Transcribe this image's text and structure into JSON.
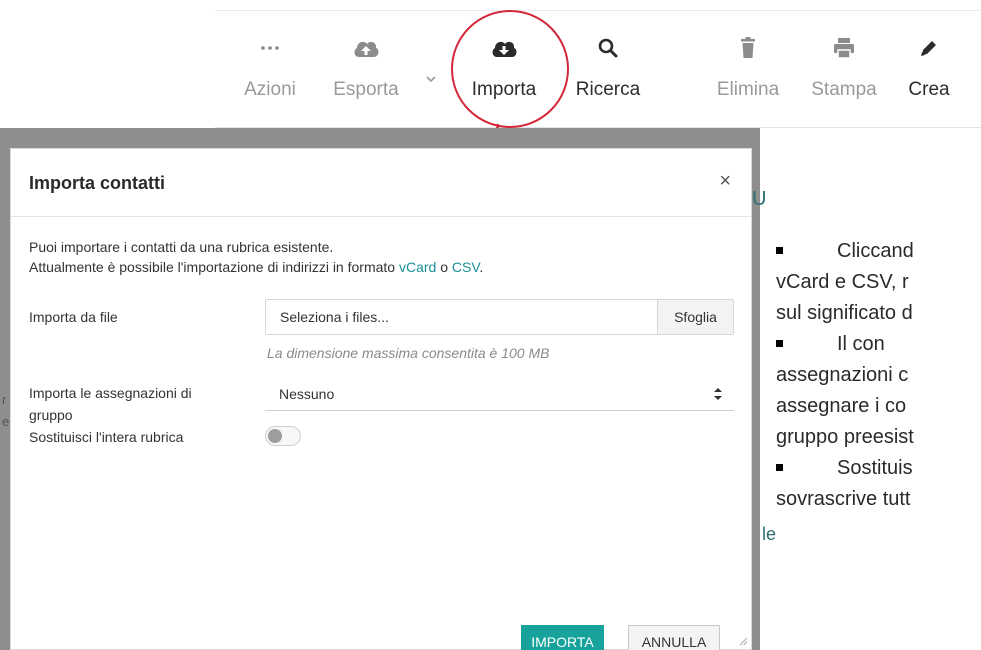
{
  "toolbar": {
    "items": [
      {
        "label": "Azioni",
        "icon": "more-icon"
      },
      {
        "label": "Esporta",
        "icon": "cloud-upload-icon"
      },
      {
        "label": "Importa",
        "icon": "cloud-download-icon"
      },
      {
        "label": "Ricerca",
        "icon": "search-icon"
      },
      {
        "label": "Elimina",
        "icon": "trash-icon"
      },
      {
        "label": "Stampa",
        "icon": "printer-icon"
      },
      {
        "label": "Crea",
        "icon": "pencil-icon"
      }
    ]
  },
  "modal": {
    "title": "Importa contatti",
    "close": "×",
    "intro_line1": "Puoi importare i contatti da una rubrica esistente.",
    "intro_line2_prefix": "Attualmente è possibile l'importazione di indirizzi in formato ",
    "intro_link_vcard": "vCard",
    "intro_conj": " o ",
    "intro_link_csv": "CSV",
    "intro_suffix": ".",
    "file_label": "Importa da file",
    "file_placeholder": "Seleziona i files...",
    "browse_label": "Sfoglia",
    "file_hint": "La dimensione massima consentita è 100 MB",
    "group_label_line1": "Importa le assegnazioni di",
    "group_label_line2": "gruppo",
    "group_value": "Nessuno",
    "replace_label": "Sostituisci l'intera rubrica",
    "replace_enabled": false,
    "import_button": "IMPORTA",
    "cancel_button": "ANNULLA"
  },
  "background": {
    "frag_u": "U",
    "frag_le": "le",
    "side_r": "r",
    "side_e": "e",
    "doc_lines": [
      "Cliccand",
      "vCard e CSV, r",
      "sul significato d",
      "Il      con",
      "assegnazioni  c",
      "assegnare i co",
      "gruppo preesist",
      "Sostituis",
      "sovrascrive tutt"
    ]
  },
  "colors": {
    "accent": "#17a39c",
    "link": "#1b8f9a",
    "highlight": "#d3283a"
  }
}
